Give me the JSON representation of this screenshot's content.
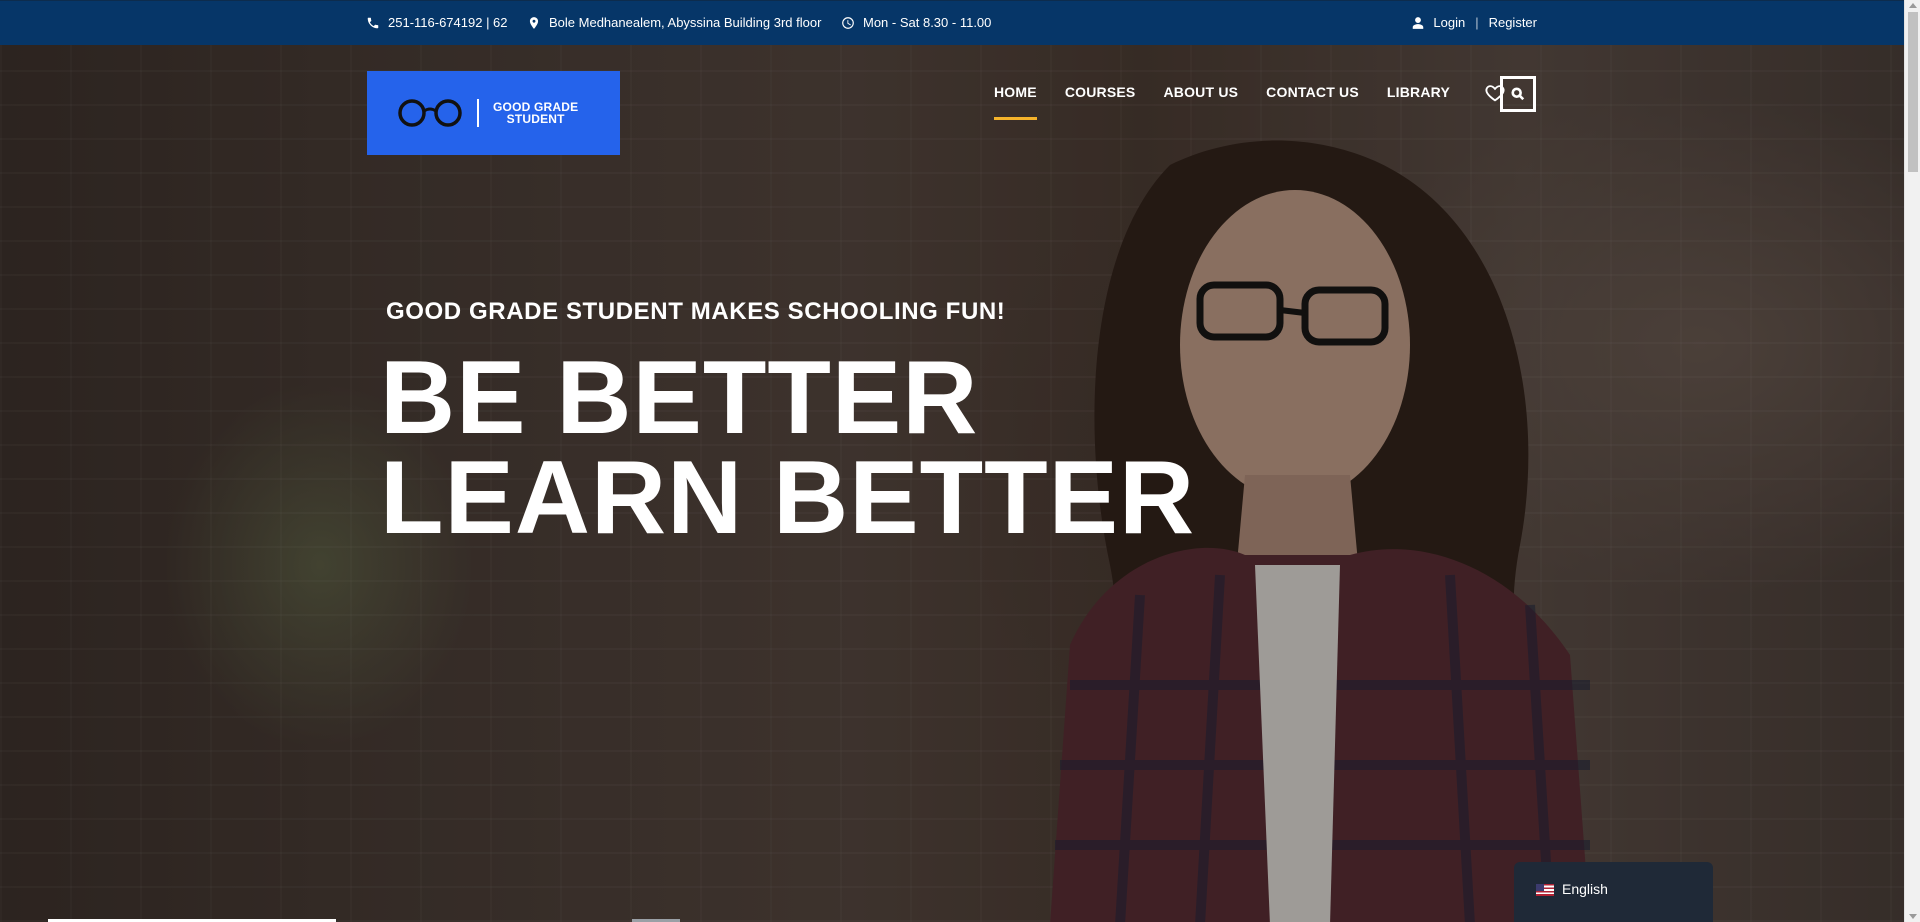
{
  "topbar": {
    "phone": "251-116-674192 | 62",
    "address": "Bole Medhanealem, Abyssina Building 3rd floor",
    "hours": "Mon - Sat 8.30 - 11.00",
    "login_label": "Login",
    "separator": "|",
    "register_label": "Register",
    "icons": [
      "phone-icon",
      "map-pin-icon",
      "clock-icon",
      "user-icon"
    ]
  },
  "logo": {
    "text_line1": "GOOD GRADE",
    "text_line2": "STUDENT",
    "icon": "glasses-icon",
    "background_color": "#2563eb"
  },
  "nav": {
    "items": [
      {
        "label": "HOME",
        "active": true
      },
      {
        "label": "COURSES",
        "active": false
      },
      {
        "label": "ABOUT US",
        "active": false
      },
      {
        "label": "CONTACT US",
        "active": false
      },
      {
        "label": "LIBRARY",
        "active": false
      }
    ],
    "wishlist_icon": "heart-icon",
    "search_icon": "search-icon",
    "active_underline_color": "#f5b32b"
  },
  "hero": {
    "tagline": "GOOD GRADE STUDENT MAKES SCHOOLING FUN!",
    "headline_line1": "BE BETTER",
    "headline_line2": "LEARN BETTER"
  },
  "language_switcher": {
    "label": "English",
    "flag": "us-flag-icon"
  },
  "colors": {
    "topbar_bg": "#063668",
    "lang_bg": "#1f2937"
  }
}
